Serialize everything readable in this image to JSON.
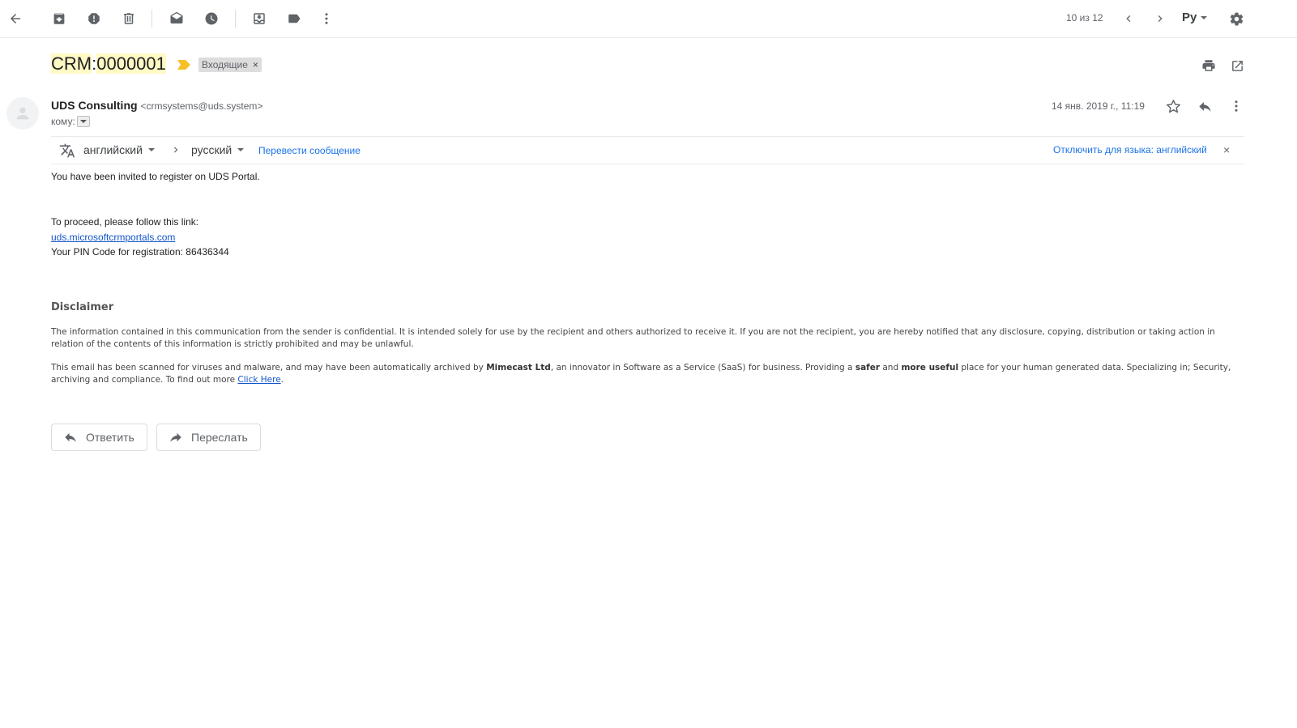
{
  "toolbar": {
    "pager": "10 из 12",
    "input_lang": "Ру"
  },
  "message": {
    "subject_part1": "CRM",
    "subject_colon": ":",
    "subject_part2": "0000001",
    "label": "Входящие",
    "sender_name": "UDS Consulting",
    "sender_email": "<crmsystems@uds.system>",
    "to_label": "кому:",
    "date": "14 янв. 2019 г., 11:19"
  },
  "translate": {
    "source_lang": "английский",
    "target_lang": "русский",
    "translate_link": "Перевести сообщение",
    "disable_link": "Отключить для языка: английский"
  },
  "body": {
    "line1": "You have been invited to register on UDS Portal.",
    "line2": "To proceed, please follow this link:",
    "link": "uds.microsoftcrmportals.com",
    "pin_line": "Your PIN Code for registration: 86436344",
    "disclaimer_title": "Disclaimer",
    "disclaimer_p1": "The information contained in this communication from the sender is confidential. It is intended solely for use by the recipient and others authorized to receive it. If you are not the recipient, you are hereby notified that any disclosure, copying, distribution or taking action in relation of the contents of this information is strictly prohibited and may be unlawful.",
    "disclaimer_p2_a": "This email has been scanned for viruses and malware, and may have been automatically archived by ",
    "disclaimer_p2_b": "Mimecast Ltd",
    "disclaimer_p2_c": ", an innovator in Software as a Service (SaaS) for business. Providing a ",
    "disclaimer_p2_d": "safer",
    "disclaimer_p2_e": " and ",
    "disclaimer_p2_f": "more useful",
    "disclaimer_p2_g": " place for your human generated data. Specializing in; Security, archiving and compliance. To find out more ",
    "disclaimer_p2_link": "Click Here",
    "disclaimer_p2_end": "."
  },
  "actions": {
    "reply": "Ответить",
    "forward": "Переслать"
  },
  "colors": {
    "accent_blue": "#1a73e8",
    "importance_marker": "#f6c026",
    "subject_highlight": "#fff9c4"
  }
}
